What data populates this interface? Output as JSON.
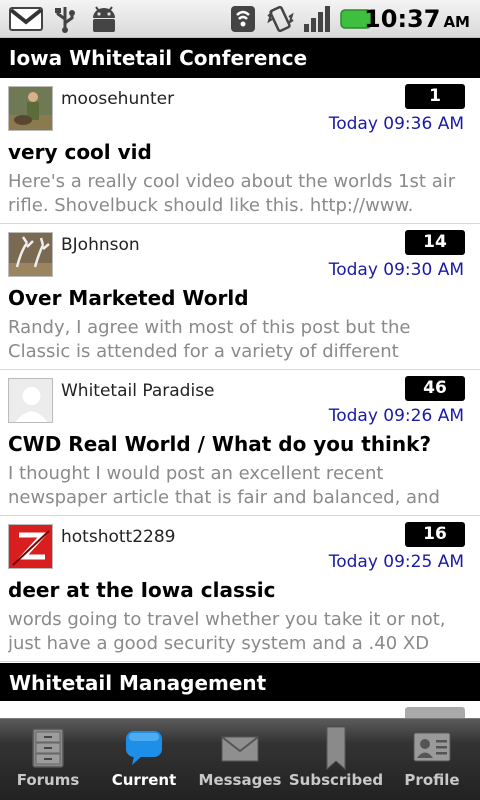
{
  "status": {
    "time": "10:37",
    "ampm": "AM"
  },
  "sections": [
    {
      "title": "Iowa Whitetail Conference",
      "topics": [
        {
          "user": "moosehunter",
          "count": "1",
          "time": "Today 09:36 AM",
          "title": "very cool vid",
          "snippet": "Here's a really cool video about the worlds 1st air rifle.  Shovelbuck should like this.   http://www."
        },
        {
          "user": "BJohnson",
          "count": "14",
          "time": "Today 09:30 AM",
          "title": "Over Marketed World",
          "snippet": "Randy,   I agree with most of this post but the Classic is attended for a variety of different"
        },
        {
          "user": "Whitetail Paradise",
          "count": "46",
          "time": "Today 09:26 AM",
          "title": "CWD Real World / What do you think?",
          "snippet": "I thought I would post an excellent recent newspaper article that is fair and balanced, and"
        },
        {
          "user": "hotshott2289",
          "count": "16",
          "time": "Today 09:25 AM",
          "title": "deer at the Iowa classic",
          "snippet": "words going to travel whether you take it or not, just have a good security system and a .40 XD"
        }
      ]
    },
    {
      "title": "Whitetail Management"
    }
  ],
  "tabs": [
    {
      "label": "Forums",
      "icon": "cabinet-icon"
    },
    {
      "label": "Current",
      "icon": "speech-bubble-icon"
    },
    {
      "label": "Messages",
      "icon": "envelope-icon"
    },
    {
      "label": "Subscribed",
      "icon": "bookmark-icon"
    },
    {
      "label": "Profile",
      "icon": "id-card-icon"
    }
  ],
  "colors": {
    "time_link": "#1a1aa6",
    "header_bg": "#000000",
    "active_tab_icon": "#1e8fe8"
  }
}
